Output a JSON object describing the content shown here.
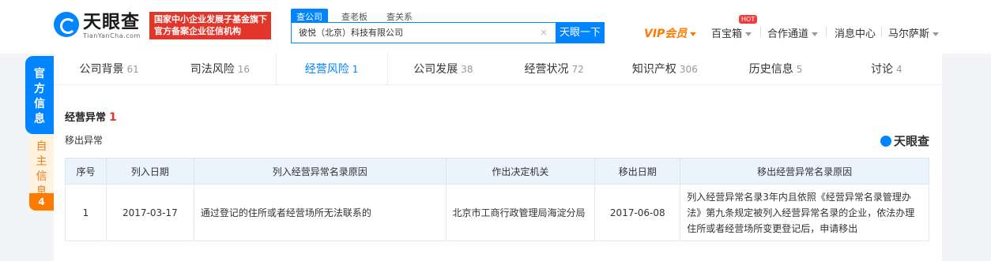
{
  "header": {
    "logo_cn": "天眼查",
    "logo_en": "TianYanCha.com",
    "badge_line1": "国家中小企业发展子基金旗下",
    "badge_line2": "官方备案企业征信机构",
    "search_tabs": [
      "查公司",
      "查老板",
      "查关系"
    ],
    "search_value": "彼悦（北京）科技有限公司",
    "search_clear": "×",
    "search_button": "天眼一下",
    "nav": {
      "vip": "VIP会员",
      "treasure": "百宝箱",
      "hot": "HOT",
      "channel": "合作通道",
      "messages": "消息中心",
      "user": "马尔萨斯"
    }
  },
  "side": {
    "official": "官方信息",
    "self": "自主信息",
    "self_count": "4"
  },
  "tabs": [
    {
      "label": "公司背景",
      "count": "61"
    },
    {
      "label": "司法风险",
      "count": "16"
    },
    {
      "label": "经营风险",
      "count": "1"
    },
    {
      "label": "公司发展",
      "count": "38"
    },
    {
      "label": "经营状况",
      "count": "72"
    },
    {
      "label": "知识产权",
      "count": "306"
    },
    {
      "label": "历史信息",
      "count": "5"
    },
    {
      "label": "讨论",
      "count": "4"
    }
  ],
  "section": {
    "title": "经营异常",
    "count": "1",
    "subtitle": "移出异常",
    "watermark": "天眼查"
  },
  "table": {
    "headers": [
      "序号",
      "列入日期",
      "列入经营异常名录原因",
      "作出决定机关",
      "移出日期",
      "移出经营异常名录原因"
    ],
    "rows": [
      {
        "index": "1",
        "in_date": "2017-03-17",
        "in_reason": "通过登记的住所或者经营场所无法联系的",
        "authority": "北京市工商行政管理局海淀分局",
        "out_date": "2017-06-08",
        "out_reason": "列入经营异常名录3年内且依照《经营异常名录管理办法》第九条规定被列入经营异常名录的企业，依法办理住所或者经营场所变更登记后，申请移出"
      }
    ]
  },
  "colors": {
    "primary": "#0084ff",
    "vip": "#ff7a00",
    "alert": "#e3362b"
  }
}
